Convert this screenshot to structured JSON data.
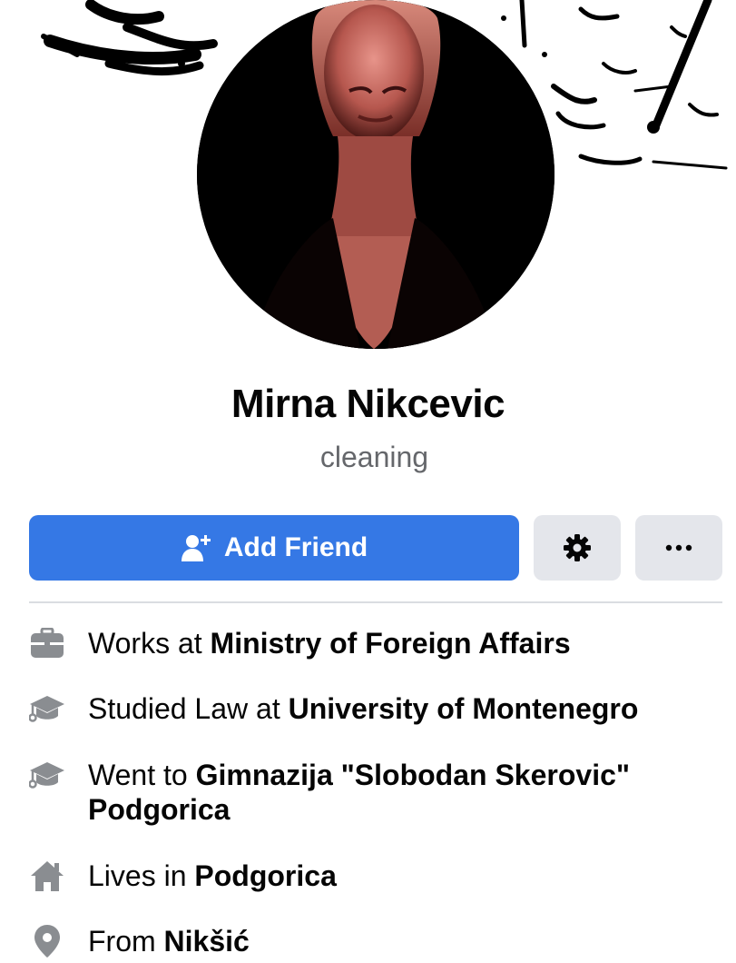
{
  "profile": {
    "name": "Mirna Nikcevic",
    "subtitle": "cleaning"
  },
  "actions": {
    "add_friend_label": "Add Friend",
    "settings_icon": "gear-icon",
    "more_icon": "more-horizontal-icon"
  },
  "colors": {
    "primary": "#3578e5",
    "secondary_button": "#e4e6eb",
    "icon": "#8a8d91",
    "muted_text": "#65676b"
  },
  "intro": [
    {
      "icon": "briefcase-icon",
      "prefix": "Works at ",
      "value": "Ministry of Foreign Affairs"
    },
    {
      "icon": "graduation-cap-icon",
      "prefix": "Studied Law at ",
      "value": "University of Montenegro"
    },
    {
      "icon": "graduation-cap-icon",
      "prefix": "Went to ",
      "value": "Gimnazija \"Slobodan Skerovic\" Podgorica"
    },
    {
      "icon": "home-icon",
      "prefix": "Lives in ",
      "value": "Podgorica"
    },
    {
      "icon": "location-pin-icon",
      "prefix": "From ",
      "value": "Nikšić"
    }
  ]
}
